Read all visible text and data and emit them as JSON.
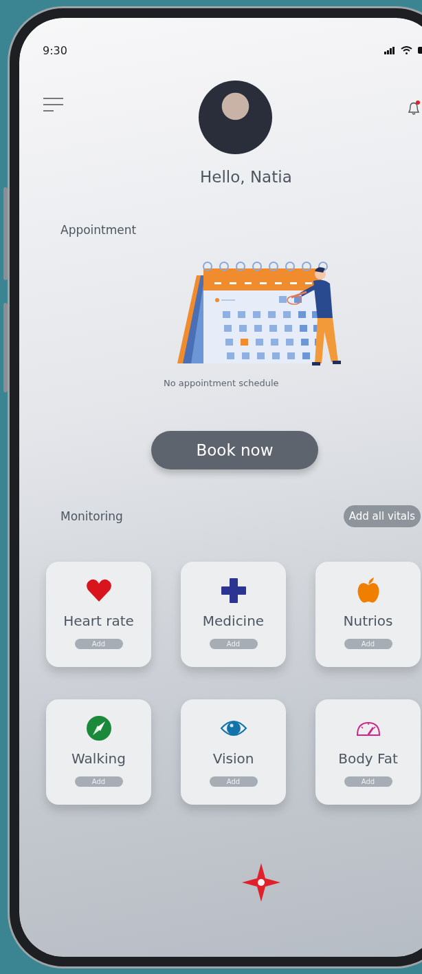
{
  "status_bar": {
    "time": "9:30"
  },
  "header": {
    "greeting": "Hello, Natia",
    "notification_badge": true
  },
  "appointment": {
    "title": "Appointment",
    "empty_message": "No appointment schedule",
    "button": "Book now"
  },
  "monitoring": {
    "title": "Monitoring",
    "action": "Add all vitals",
    "cards": [
      {
        "kind": "heart",
        "label": "Heart rate",
        "button": "Add"
      },
      {
        "kind": "cross",
        "label": "Medicine",
        "button": "Add"
      },
      {
        "kind": "apple",
        "label": "Nutrios",
        "button": "Add"
      },
      {
        "kind": "compass",
        "label": "Walking",
        "button": "Add"
      },
      {
        "kind": "eye",
        "label": "Vision",
        "button": "Add"
      },
      {
        "kind": "gauge",
        "label": "Body Fat",
        "button": "Add"
      }
    ]
  }
}
